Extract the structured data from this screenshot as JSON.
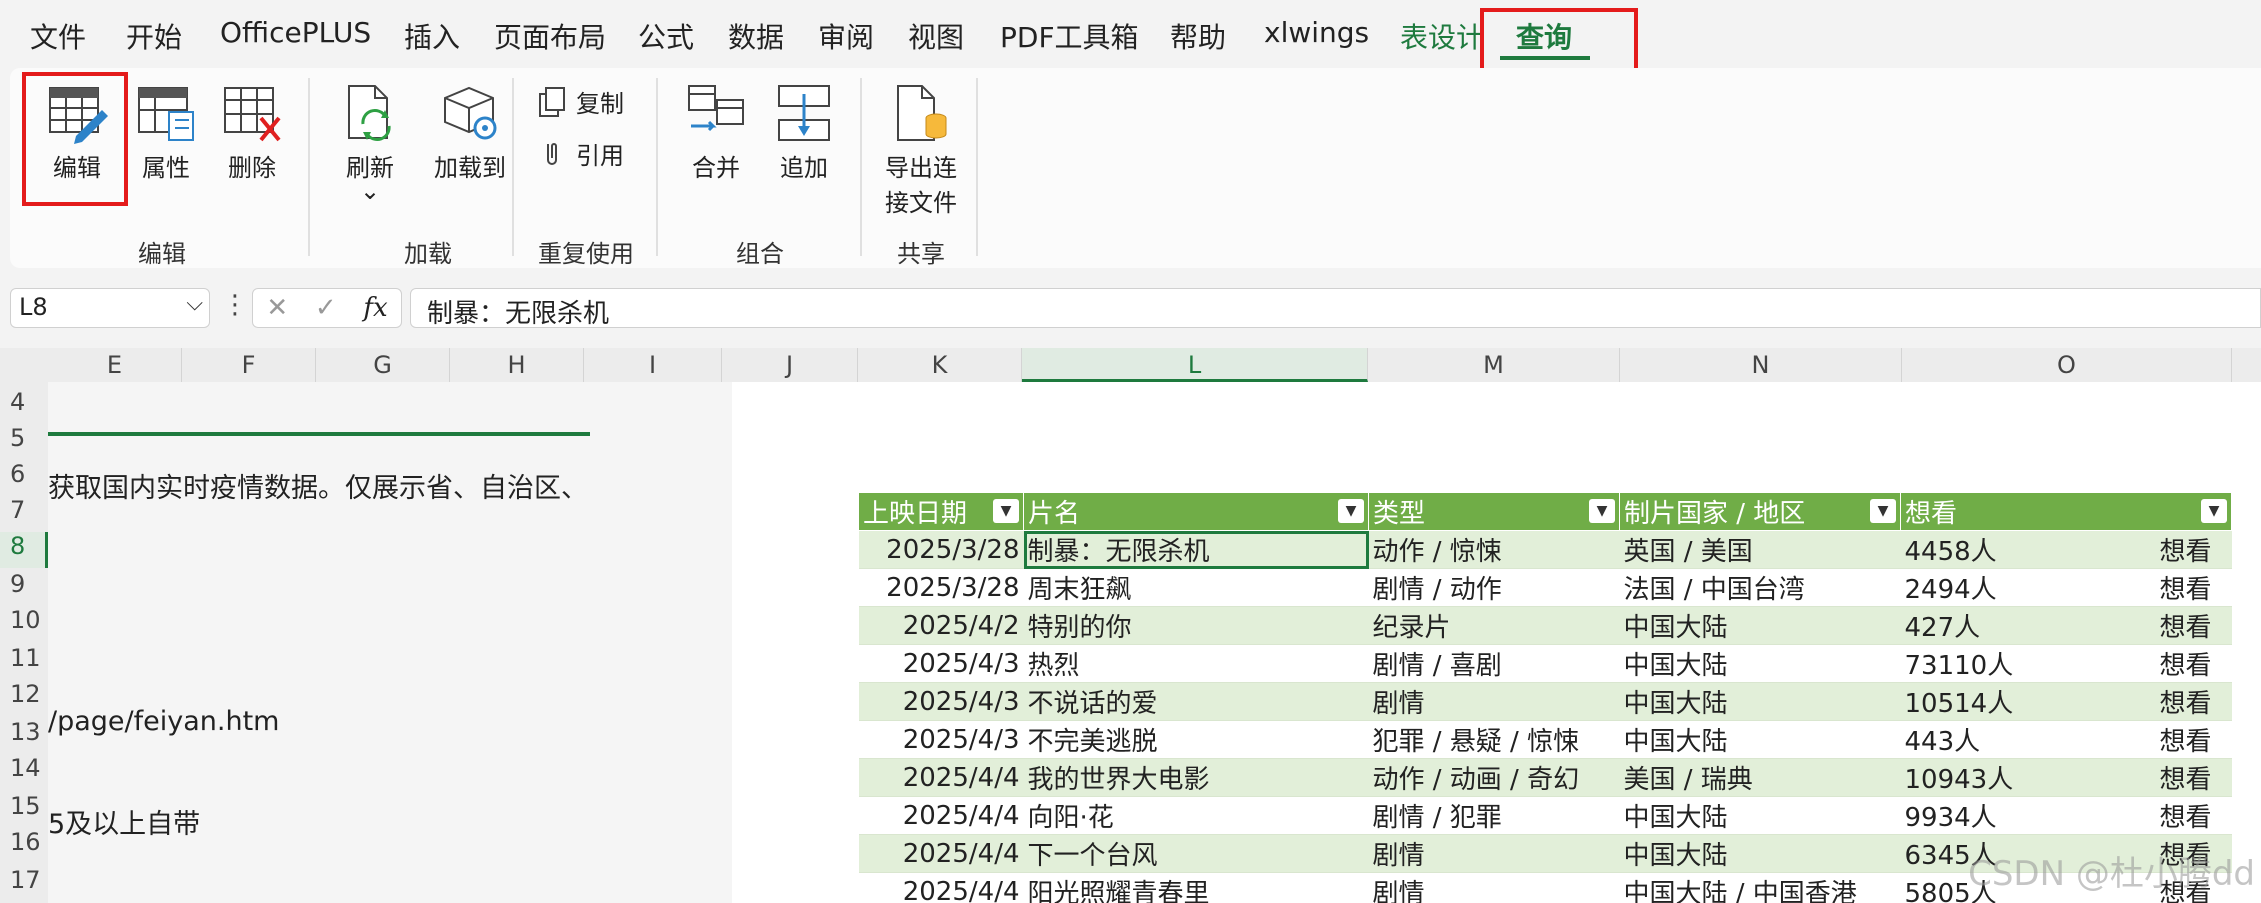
{
  "menu": {
    "tabs": [
      "文件",
      "开始",
      "OfficePLUS",
      "插入",
      "页面布局",
      "公式",
      "数据",
      "审阅",
      "视图",
      "PDF工具箱",
      "帮助",
      "xlwings",
      "表设计",
      "查询"
    ],
    "active_tab": "查询"
  },
  "ribbon": {
    "edit_group": {
      "label": "编辑",
      "buttons": [
        "编辑",
        "属性",
        "删除"
      ]
    },
    "load_group": {
      "label": "加载",
      "refresh": "刷新",
      "refresh_arrow": "⌄",
      "load_to": "加载到"
    },
    "reuse_group": {
      "label": "重复使用",
      "copy": "复制",
      "reference": "引用"
    },
    "combine_group": {
      "label": "组合",
      "merge": "合并",
      "append": "追加"
    },
    "share_group": {
      "label": "共享",
      "export_line1": "导出连",
      "export_line2": "接文件"
    }
  },
  "formula_bar": {
    "name_box": "L8",
    "content": "制暴：无限杀机",
    "fx": "fx"
  },
  "columns": [
    "E",
    "F",
    "G",
    "H",
    "I",
    "J",
    "K",
    "L",
    "M",
    "N",
    "O"
  ],
  "rows": [
    "4",
    "5",
    "6",
    "7",
    "8",
    "9",
    "10",
    "11",
    "12",
    "13",
    "14",
    "15",
    "16",
    "17"
  ],
  "left_text": {
    "row6": "获取国内实时疫情数据。仅展示省、自治区、",
    "row13": "/page/feiyan.htm",
    "row15": "5及以上自带"
  },
  "table": {
    "headers": [
      "上映日期",
      "片名",
      "类型",
      "制片国家 / 地区",
      "想看"
    ],
    "rows": [
      {
        "date": "2025/3/28",
        "title": "制暴：无限杀机",
        "genre": "动作 / 惊悚",
        "region": "英国 / 美国",
        "count": "4458人",
        "btn": "想看"
      },
      {
        "date": "2025/3/28",
        "title": "周末狂飙",
        "genre": "剧情 / 动作",
        "region": "法国 / 中国台湾",
        "count": "2494人",
        "btn": "想看"
      },
      {
        "date": "2025/4/2",
        "title": "特别的你",
        "genre": "纪录片",
        "region": "中国大陆",
        "count": "427人",
        "btn": "想看"
      },
      {
        "date": "2025/4/3",
        "title": "热烈",
        "genre": "剧情 / 喜剧",
        "region": "中国大陆",
        "count": "73110人",
        "btn": "想看"
      },
      {
        "date": "2025/4/3",
        "title": "不说话的爱",
        "genre": "剧情",
        "region": "中国大陆",
        "count": "10514人",
        "btn": "想看"
      },
      {
        "date": "2025/4/3",
        "title": "不完美逃脱",
        "genre": "犯罪 / 悬疑 / 惊悚",
        "region": "中国大陆",
        "count": "443人",
        "btn": "想看"
      },
      {
        "date": "2025/4/4",
        "title": "我的世界大电影",
        "genre": "动作 / 动画 / 奇幻",
        "region": "美国 / 瑞典",
        "count": "10943人",
        "btn": "想看"
      },
      {
        "date": "2025/4/4",
        "title": "向阳·花",
        "genre": "剧情 / 犯罪",
        "region": "中国大陆",
        "count": "9934人",
        "btn": "想看"
      },
      {
        "date": "2025/4/4",
        "title": "下一个台风",
        "genre": "剧情",
        "region": "中国大陆",
        "count": "6345人",
        "btn": "想看"
      },
      {
        "date": "2025/4/4",
        "title": "阳光照耀青春里",
        "genre": "剧情",
        "region": "中国大陆 / 中国香港",
        "count": "5805人",
        "btn": "想看"
      }
    ]
  },
  "watermark": "CSDN @杜小腾dd"
}
